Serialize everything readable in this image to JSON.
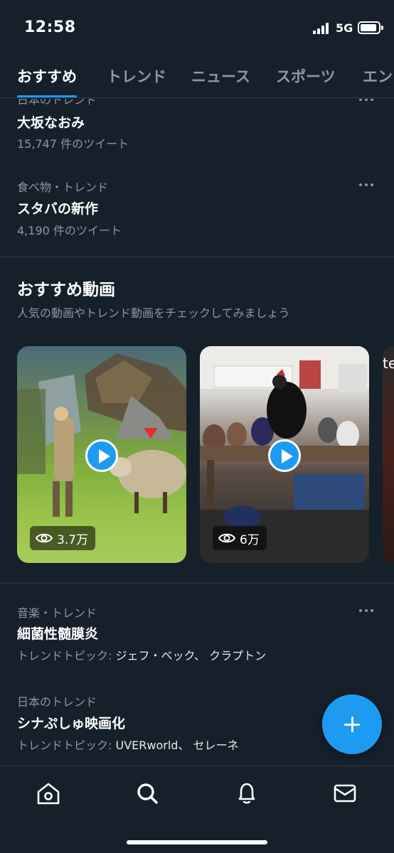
{
  "status_bar": {
    "time": "12:58",
    "network": "5G"
  },
  "tabs": [
    {
      "label": "おすすめ",
      "active": true
    },
    {
      "label": "トレンド",
      "active": false
    },
    {
      "label": "ニュース",
      "active": false
    },
    {
      "label": "スポーツ",
      "active": false
    },
    {
      "label": "エン",
      "active": false
    }
  ],
  "trends_top": [
    {
      "category": "日本のトレンド",
      "title": "大坂なおみ",
      "subtitle": "15,747 件のツイート"
    },
    {
      "category": "食べ物・トレンド",
      "title": "スタバの新作",
      "subtitle": "4,190 件のツイート"
    }
  ],
  "video_section": {
    "title": "おすすめ動画",
    "subtitle": "人気の動画やトレンド動画をチェックしてみましょう",
    "videos": [
      {
        "views": "3.7万"
      },
      {
        "views": "6万"
      },
      {
        "caption": "te"
      }
    ]
  },
  "trends_bottom": [
    {
      "category": "音楽・トレンド",
      "title": "細菌性髄膜炎",
      "topic_label": "トレンドトピック:",
      "topic_names": "ジェフ・ベック、 クラプトン"
    },
    {
      "category": "日本のトレンド",
      "title": "シナぷしゅ映画化",
      "topic_label": "トレンドトピック:",
      "topic_names": "UVERworld、 セレーネ"
    }
  ],
  "bottom_nav": [
    "home-icon",
    "search-icon",
    "notifications-icon",
    "messages-icon"
  ],
  "colors": {
    "accent": "#1d9bf0",
    "background": "#15202b",
    "secondary_text": "#8b98a5"
  }
}
